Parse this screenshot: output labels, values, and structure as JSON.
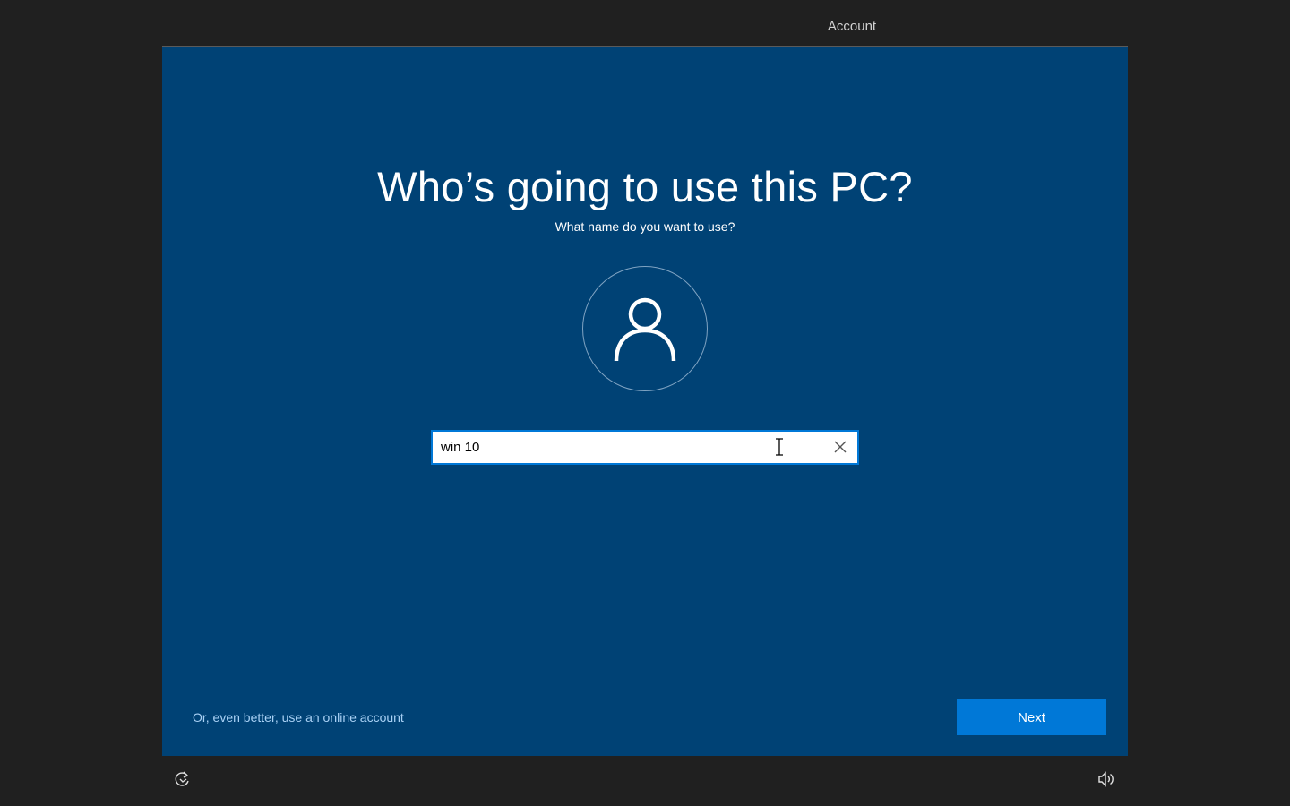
{
  "header": {
    "active_step": "Account"
  },
  "main": {
    "title": "Who’s going to use this PC?",
    "subtitle": "What name do you want to use?",
    "avatar_icon": "user-icon",
    "name_input": {
      "value": "win 10",
      "clear_icon": "close-icon"
    }
  },
  "footer": {
    "online_account_link": "Or, even better, use an online account",
    "next_label": "Next",
    "ease_of_access_icon": "ease-of-access-icon",
    "volume_icon": "volume-icon"
  },
  "colors": {
    "background": "#202020",
    "panel": "#004275",
    "accent": "#0078d7",
    "link": "#a9d1f5"
  }
}
